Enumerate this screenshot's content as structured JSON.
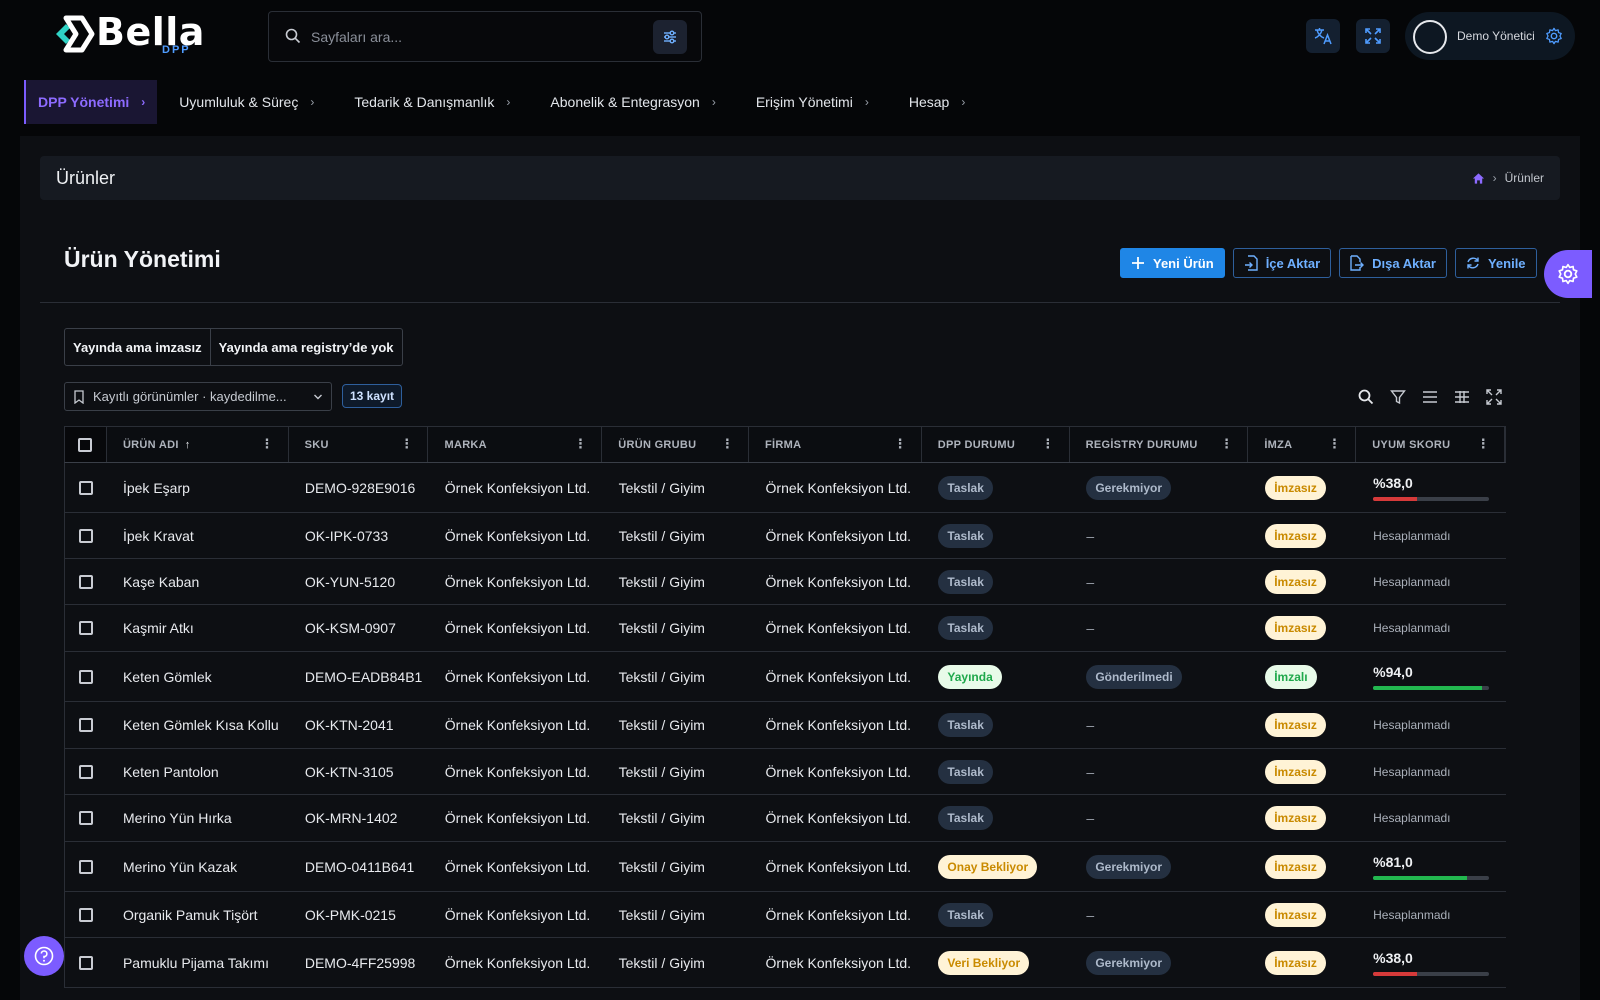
{
  "brand": {
    "name": "Bella",
    "sub": "DPP",
    "accent": "#7c5cff",
    "primary_blue": "#1f86e6"
  },
  "search": {
    "placeholder": "Sayfaları ara..."
  },
  "user": {
    "name": "Demo Yönetici"
  },
  "nav": [
    {
      "label": "DPP Yönetimi",
      "active": true
    },
    {
      "label": "Uyumluluk & Süreç"
    },
    {
      "label": "Tedarik & Danışmanlık"
    },
    {
      "label": "Abonelik & Entegrasyon"
    },
    {
      "label": "Erişim Yönetimi"
    },
    {
      "label": "Hesap"
    }
  ],
  "page": {
    "title": "Ürünler",
    "breadcrumb_current": "Ürünler"
  },
  "section": {
    "title": "Ürün Yönetimi"
  },
  "actions": {
    "new": "Yeni Ürün",
    "import": "İçe Aktar",
    "export": "Dışa Aktar",
    "refresh": "Yenile"
  },
  "quick_filters": [
    "Yayında ama imzasız",
    "Yayında ama registry’de yok"
  ],
  "views": {
    "label": "Kayıtlı görünümler · kaydedilme..."
  },
  "record_count": "13 kayıt",
  "table": {
    "columns": [
      "ÜRÜN ADI",
      "SKU",
      "MARKA",
      "ÜRÜN GRUBU",
      "FİRMA",
      "DPP DURUMU",
      "REGİSTRY DURUMU",
      "İMZA",
      "UYUM SKORU"
    ],
    "rows": [
      {
        "name": "İpek Eşarp",
        "sku": "DEMO-928E9016",
        "brand": "Örnek Konfeksiyon Ltd.",
        "group": "Tekstil / Giyim",
        "company": "Örnek Konfeksiyon Ltd.",
        "dpp": "Taslak",
        "dpp_kind": "draft",
        "registry": "Gerekmiyor",
        "sign": "İmzasız",
        "sign_kind": "unsig",
        "score": "%38,0",
        "score_pct": 38,
        "score_color": "#d63a3a"
      },
      {
        "name": "İpek Kravat",
        "sku": "OK-IPK-0733",
        "brand": "Örnek Konfeksiyon Ltd.",
        "group": "Tekstil / Giyim",
        "company": "Örnek Konfeksiyon Ltd.",
        "dpp": "Taslak",
        "dpp_kind": "draft",
        "registry": "–",
        "sign": "İmzasız",
        "sign_kind": "unsig",
        "score": "Hesaplanmadı"
      },
      {
        "name": "Kaşe Kaban",
        "sku": "OK-YUN-5120",
        "brand": "Örnek Konfeksiyon Ltd.",
        "group": "Tekstil / Giyim",
        "company": "Örnek Konfeksiyon Ltd.",
        "dpp": "Taslak",
        "dpp_kind": "draft",
        "registry": "–",
        "sign": "İmzasız",
        "sign_kind": "unsig",
        "score": "Hesaplanmadı"
      },
      {
        "name": "Kaşmir Atkı",
        "sku": "OK-KSM-0907",
        "brand": "Örnek Konfeksiyon Ltd.",
        "group": "Tekstil / Giyim",
        "company": "Örnek Konfeksiyon Ltd.",
        "dpp": "Taslak",
        "dpp_kind": "draft",
        "registry": "–",
        "sign": "İmzasız",
        "sign_kind": "unsig",
        "score": "Hesaplanmadı"
      },
      {
        "name": "Keten Gömlek",
        "sku": "DEMO-EADB84B1",
        "brand": "Örnek Konfeksiyon Ltd.",
        "group": "Tekstil / Giyim",
        "company": "Örnek Konfeksiyon Ltd.",
        "dpp": "Yayında",
        "dpp_kind": "live",
        "registry": "Gönderilmedi",
        "sign": "İmzalı",
        "sign_kind": "sig",
        "score": "%94,0",
        "score_pct": 94,
        "score_color": "#22b84f"
      },
      {
        "name": "Keten Gömlek Kısa Kollu",
        "sku": "OK-KTN-2041",
        "brand": "Örnek Konfeksiyon Ltd.",
        "group": "Tekstil / Giyim",
        "company": "Örnek Konfeksiyon Ltd.",
        "dpp": "Taslak",
        "dpp_kind": "draft",
        "registry": "–",
        "sign": "İmzasız",
        "sign_kind": "unsig",
        "score": "Hesaplanmadı"
      },
      {
        "name": "Keten Pantolon",
        "sku": "OK-KTN-3105",
        "brand": "Örnek Konfeksiyon Ltd.",
        "group": "Tekstil / Giyim",
        "company": "Örnek Konfeksiyon Ltd.",
        "dpp": "Taslak",
        "dpp_kind": "draft",
        "registry": "–",
        "sign": "İmzasız",
        "sign_kind": "unsig",
        "score": "Hesaplanmadı"
      },
      {
        "name": "Merino Yün Hırka",
        "sku": "OK-MRN-1402",
        "brand": "Örnek Konfeksiyon Ltd.",
        "group": "Tekstil / Giyim",
        "company": "Örnek Konfeksiyon Ltd.",
        "dpp": "Taslak",
        "dpp_kind": "draft",
        "registry": "–",
        "sign": "İmzasız",
        "sign_kind": "unsig",
        "score": "Hesaplanmadı"
      },
      {
        "name": "Merino Yün Kazak",
        "sku": "DEMO-0411B641",
        "brand": "Örnek Konfeksiyon Ltd.",
        "group": "Tekstil / Giyim",
        "company": "Örnek Konfeksiyon Ltd.",
        "dpp": "Onay Bekliyor",
        "dpp_kind": "wait",
        "registry": "Gerekmiyor",
        "sign": "İmzasız",
        "sign_kind": "unsig",
        "score": "%81,0",
        "score_pct": 81,
        "score_color": "#22b84f"
      },
      {
        "name": "Organik Pamuk Tişört",
        "sku": "OK-PMK-0215",
        "brand": "Örnek Konfeksiyon Ltd.",
        "group": "Tekstil / Giyim",
        "company": "Örnek Konfeksiyon Ltd.",
        "dpp": "Taslak",
        "dpp_kind": "draft",
        "registry": "–",
        "sign": "İmzasız",
        "sign_kind": "unsig",
        "score": "Hesaplanmadı"
      },
      {
        "name": "Pamuklu Pijama Takımı",
        "sku": "DEMO-4FF25998",
        "brand": "Örnek Konfeksiyon Ltd.",
        "group": "Tekstil / Giyim",
        "company": "Örnek Konfeksiyon Ltd.",
        "dpp": "Veri Bekliyor",
        "dpp_kind": "wait",
        "registry": "Gerekmiyor",
        "sign": "İmzasız",
        "sign_kind": "unsig",
        "score": "%38,0",
        "score_pct": 38,
        "score_color": "#d63a3a"
      }
    ]
  }
}
